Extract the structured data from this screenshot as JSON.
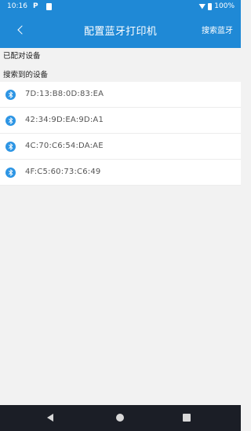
{
  "status_bar": {
    "time": "10:16",
    "p_icon": "P",
    "battery": "100%"
  },
  "toolbar": {
    "title": "配置蓝牙打印机",
    "search_label": "搜索蓝牙"
  },
  "sections": {
    "paired_label": "已配对设备",
    "found_label": "搜索到的设备"
  },
  "devices": [
    {
      "mac": "7D:13:B8:0D:83:EA"
    },
    {
      "mac": "42:34:9D:EA:9D:A1"
    },
    {
      "mac": "4C:70:C6:54:DA:AE"
    },
    {
      "mac": "4F:C5:60:73:C6:49"
    }
  ],
  "colors": {
    "header": "#1f89d6",
    "bluetooth_icon": "#2d95e4",
    "background": "#f2f2f2",
    "nav_bar": "#1b1e26"
  }
}
